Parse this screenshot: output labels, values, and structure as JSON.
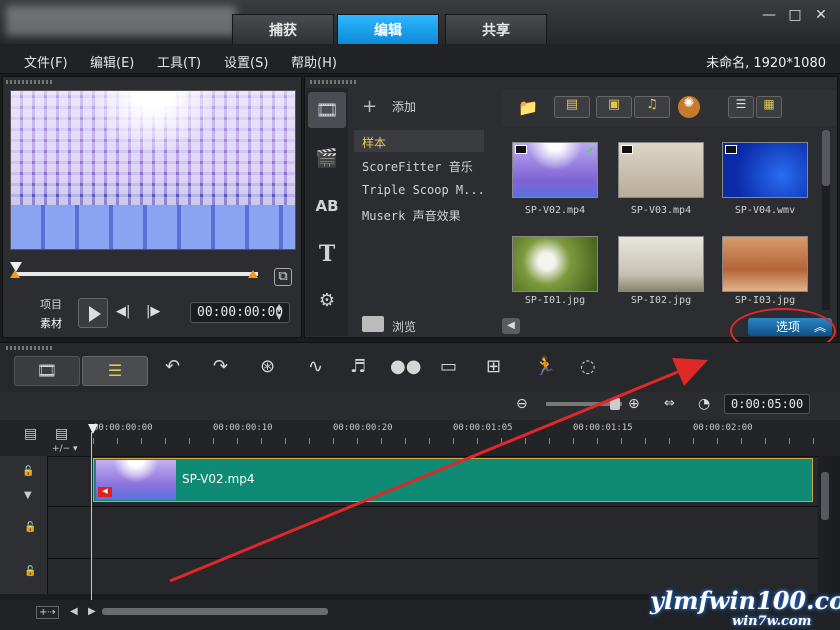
{
  "window": {
    "tabs": [
      {
        "label": "捕获"
      },
      {
        "label": "编辑",
        "active": true
      },
      {
        "label": "共享"
      }
    ],
    "controls": {
      "minimize": "—",
      "maximize": "□",
      "close": "✕"
    }
  },
  "menu": {
    "items": [
      "文件(F)",
      "编辑(E)",
      "工具(T)",
      "设置(S)",
      "帮助(H)"
    ],
    "project_info": "未命名, 1920*1080"
  },
  "player": {
    "mode_project": "项目",
    "mode_clip": "素材",
    "timecode": "00:00:00:00",
    "play_icon": "play-icon"
  },
  "library": {
    "add_label": "添加",
    "items": [
      "样本",
      "ScoreFitter 音乐",
      "Triple Scoop M...",
      "Muserk 声音效果"
    ],
    "browse_label": "浏览",
    "options_label": "选项",
    "thumbnails": [
      {
        "name": "SP-V02.mp4",
        "type": "video",
        "checked": true
      },
      {
        "name": "SP-V03.mp4",
        "type": "video"
      },
      {
        "name": "SP-V04.wmv",
        "type": "video"
      },
      {
        "name": "SP-I01.jpg",
        "type": "image"
      },
      {
        "name": "SP-I02.jpg",
        "type": "image"
      },
      {
        "name": "SP-I03.jpg",
        "type": "image"
      }
    ]
  },
  "timeline": {
    "duration": "0:00:05:00",
    "ruler": [
      "00:00:00:00",
      "00:00:00:10",
      "00:00:00:20",
      "00:00:01:05",
      "00:00:01:15",
      "00:00:02:00"
    ],
    "clip": {
      "name": "SP-V02.mp4"
    }
  },
  "watermark": {
    "main": "ylmfwin100.com",
    "sub": "win7w.com"
  },
  "colors": {
    "active_tab": "#1a9ae8",
    "clip_fill": "#0f8a74",
    "annotation": "#e02828",
    "accent_yellow": "#e2c84a"
  }
}
